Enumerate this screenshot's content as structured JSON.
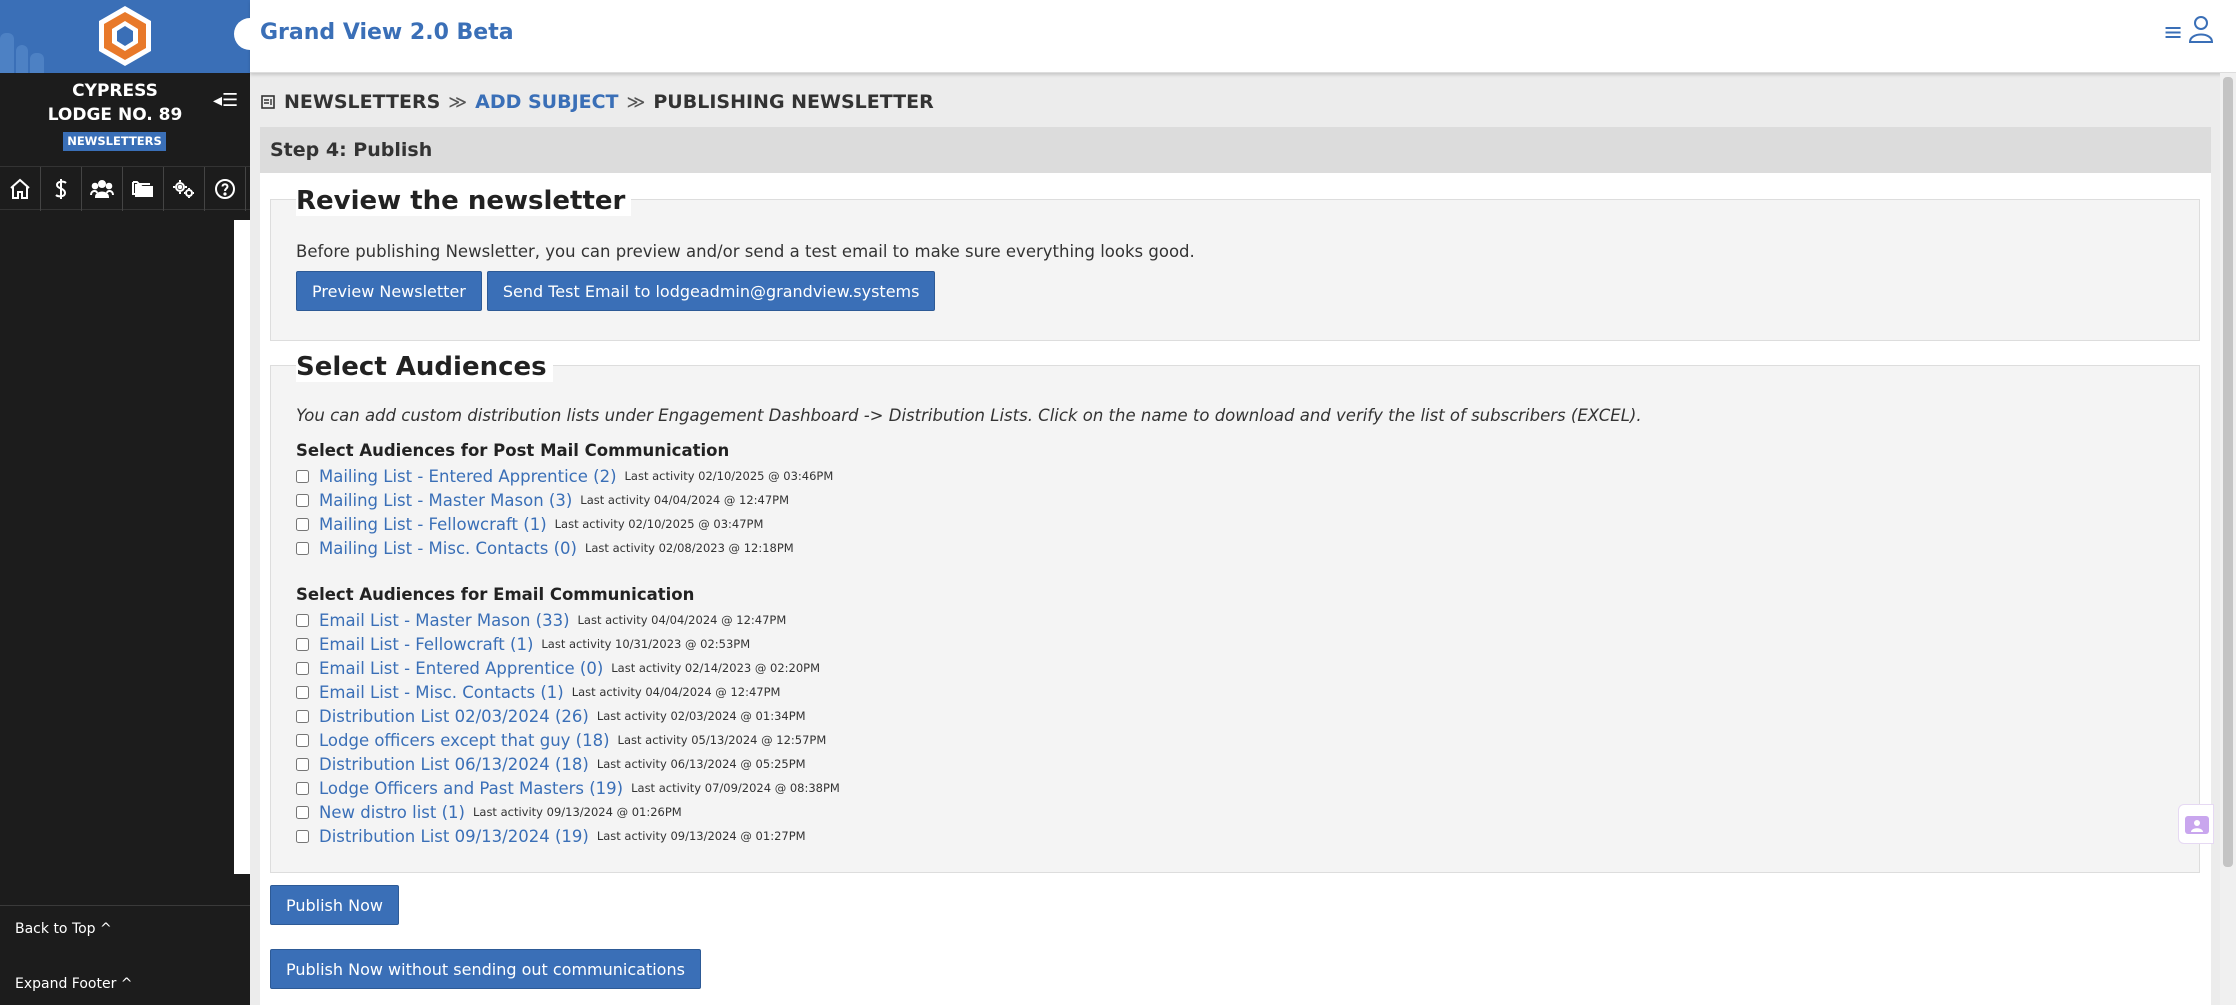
{
  "app": {
    "title": "Grand View 2.0 Beta"
  },
  "sidebar": {
    "lodge_line1": "CYPRESS",
    "lodge_line2": "LODGE NO. 89",
    "module_badge": "NEWSLETTERS",
    "nav_icons": [
      "home-icon",
      "dollar-icon",
      "members-icon",
      "folders-icon",
      "settings-icon",
      "help-icon"
    ],
    "back_to_top": "Back to Top ^",
    "expand_footer": "Expand Footer ^"
  },
  "breadcrumb": {
    "item1": "NEWSLETTERS",
    "item2": "ADD SUBJECT",
    "item3": "PUBLISHING NEWSLETTER"
  },
  "step": {
    "title": "Step 4: Publish"
  },
  "review": {
    "heading": "Review the newsletter",
    "description": "Before publishing Newsletter, you can preview and/or send a test email to make sure everything looks good.",
    "preview_button": "Preview Newsletter",
    "test_email_button": "Send Test Email to lodgeadmin@grandview.systems"
  },
  "audiences": {
    "heading": "Select Audiences",
    "note": "You can add custom distribution lists under Engagement Dashboard -> Distribution Lists. Click on the name to download and verify the list of subscribers (EXCEL).",
    "post_mail_label": "Select Audiences for Post Mail Communication",
    "post_mail_lists": [
      {
        "name": "Mailing List - Entered Apprentice (2)",
        "meta": "Last activity 02/10/2025 @ 03:46PM"
      },
      {
        "name": "Mailing List - Master Mason (3)",
        "meta": "Last activity 04/04/2024 @ 12:47PM"
      },
      {
        "name": "Mailing List - Fellowcraft (1)",
        "meta": "Last activity 02/10/2025 @ 03:47PM"
      },
      {
        "name": "Mailing List - Misc. Contacts (0)",
        "meta": "Last activity 02/08/2023 @ 12:18PM"
      }
    ],
    "email_label": "Select Audiences for Email Communication",
    "email_lists": [
      {
        "name": "Email List - Master Mason (33)",
        "meta": "Last activity 04/04/2024 @ 12:47PM"
      },
      {
        "name": "Email List - Fellowcraft (1)",
        "meta": "Last activity 10/31/2023 @ 02:53PM"
      },
      {
        "name": "Email List - Entered Apprentice (0)",
        "meta": "Last activity 02/14/2023 @ 02:20PM"
      },
      {
        "name": "Email List - Misc. Contacts (1)",
        "meta": "Last activity 04/04/2024 @ 12:47PM"
      },
      {
        "name": "Distribution List 02/03/2024 (26)",
        "meta": "Last activity 02/03/2024 @ 01:34PM"
      },
      {
        "name": "Lodge officers except that guy (18)",
        "meta": "Last activity 05/13/2024 @ 12:57PM"
      },
      {
        "name": "Distribution List 06/13/2024 (18)",
        "meta": "Last activity 06/13/2024 @ 05:25PM"
      },
      {
        "name": "Lodge Officers and Past Masters (19)",
        "meta": "Last activity 07/09/2024 @ 08:38PM"
      },
      {
        "name": "New distro list (1)",
        "meta": "Last activity 09/13/2024 @ 01:26PM"
      },
      {
        "name": "Distribution List 09/13/2024 (19)",
        "meta": "Last activity 09/13/2024 @ 01:27PM"
      }
    ]
  },
  "actions": {
    "publish_now": "Publish Now",
    "publish_silent": "Publish Now without sending out communications"
  },
  "colors": {
    "accent": "#3a6fb7",
    "sidebar_bg": "#1c1c1c",
    "logo_orange": "#e8792a"
  }
}
